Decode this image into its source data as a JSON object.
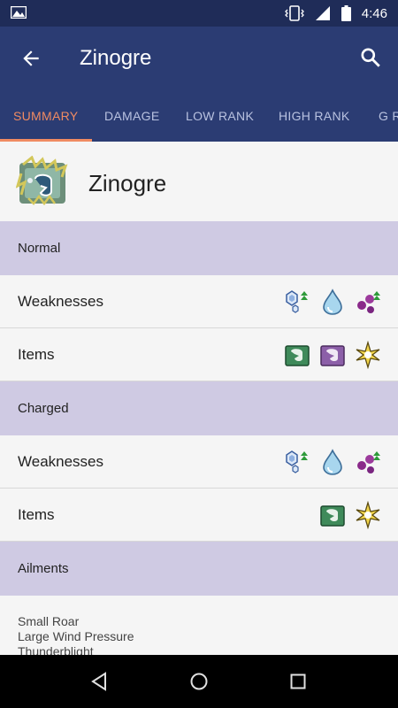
{
  "status_bar": {
    "time": "4:46",
    "icons": [
      "image-icon",
      "vibrate-icon",
      "signal-icon",
      "battery-icon"
    ]
  },
  "app_bar": {
    "title": "Zinogre",
    "back_icon": "back-arrow-icon",
    "search_icon": "search-icon"
  },
  "tabs": [
    {
      "label": "SUMMARY",
      "active": true
    },
    {
      "label": "DAMAGE",
      "active": false
    },
    {
      "label": "LOW RANK",
      "active": false
    },
    {
      "label": "HIGH RANK",
      "active": false
    },
    {
      "label": "G R",
      "active": false
    }
  ],
  "monster": {
    "name": "Zinogre",
    "icon": "zinogre-monster-icon"
  },
  "sections": [
    {
      "title": "Normal",
      "rows": [
        {
          "label": "Weaknesses",
          "icons": [
            "ice-weakness-icon",
            "water-weakness-icon",
            "poison-weakness-icon"
          ]
        },
        {
          "label": "Items",
          "icons": [
            "pitfall-trap-icon",
            "shock-trap-icon",
            "flash-bomb-icon"
          ]
        }
      ]
    },
    {
      "title": "Charged",
      "rows": [
        {
          "label": "Weaknesses",
          "icons": [
            "ice-weakness-icon",
            "water-weakness-icon",
            "poison-weakness-icon"
          ]
        },
        {
          "label": "Items",
          "icons": [
            "pitfall-trap-icon",
            "flash-bomb-icon"
          ]
        }
      ]
    }
  ],
  "ailments": {
    "title": "Ailments",
    "items": [
      "Small Roar",
      "Large Wind Pressure",
      "Thunderblight"
    ]
  },
  "colors": {
    "status_bar": "#1f2c58",
    "app_bar": "#2b3c73",
    "accent": "#f08b62",
    "section_bg": "#cfcae3",
    "content_bg": "#f5f5f5"
  }
}
